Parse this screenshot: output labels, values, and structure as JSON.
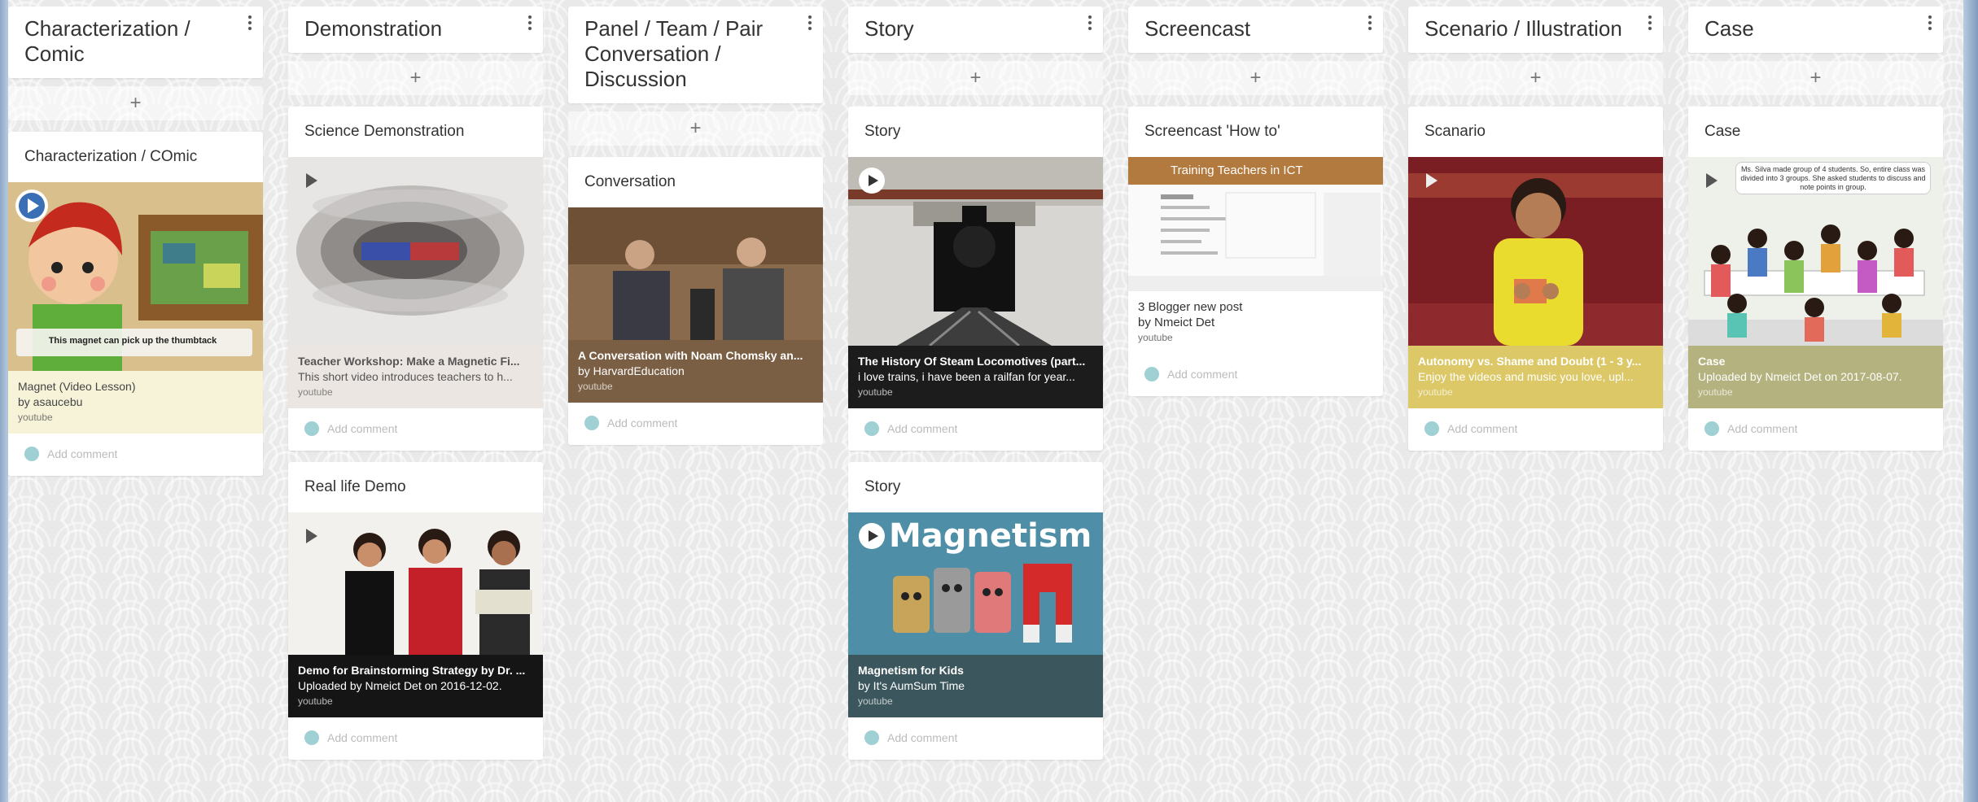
{
  "columns": [
    {
      "title": "Characterization / Comic",
      "add_label": "+",
      "posts": [
        {
          "title": "Characterization / COmic",
          "attachment": {
            "title": "Magnet (Video Lesson)",
            "description": "by asaucebu",
            "source": "youtube",
            "caption": "This magnet can pick up the thumbtack"
          },
          "comment_placeholder": "Add comment"
        }
      ]
    },
    {
      "title": "Demonstration",
      "add_label": "+",
      "posts": [
        {
          "title": "Science Demonstration",
          "attachment": {
            "title": "Teacher Workshop: Make a Magnetic Fi...",
            "description": "This short video introduces teachers to h...",
            "source": "youtube"
          },
          "comment_placeholder": "Add comment"
        },
        {
          "title": "Real life Demo",
          "attachment": {
            "title": "Demo for Brainstorming Strategy by Dr. ...",
            "description": "Uploaded by Nmeict Det on 2016-12-02.",
            "source": "youtube"
          },
          "comment_placeholder": "Add comment"
        }
      ]
    },
    {
      "title": "Panel / Team / Pair Conversation / Discussion",
      "add_label": "+",
      "posts": [
        {
          "title": "Conversation",
          "attachment": {
            "title": "A Conversation with Noam Chomsky an...",
            "description": "by HarvardEducation",
            "source": "youtube"
          },
          "comment_placeholder": "Add comment"
        }
      ]
    },
    {
      "title": "Story",
      "add_label": "+",
      "posts": [
        {
          "title": "Story",
          "attachment": {
            "title": "The History Of Steam Locomotives (part...",
            "description": "i love trains, i have been a railfan for year...",
            "source": "youtube"
          },
          "comment_placeholder": "Add comment"
        },
        {
          "title": "Story",
          "attachment": {
            "title": "Magnetism for Kids",
            "description": "by It's AumSum Time",
            "source": "youtube",
            "caption": "Magnetism"
          },
          "comment_placeholder": "Add comment"
        }
      ]
    },
    {
      "title": "Screencast",
      "add_label": "+",
      "posts": [
        {
          "title": "Screencast 'How to'",
          "attachment": {
            "title": "3 Blogger new post",
            "description": "by Nmeict Det",
            "source": "youtube",
            "caption": "Training Teachers in ICT"
          },
          "comment_placeholder": "Add comment"
        }
      ]
    },
    {
      "title": "Scenario / Illustration",
      "add_label": "+",
      "posts": [
        {
          "title": "Scanario",
          "attachment": {
            "title": "Autonomy vs. Shame and Doubt (1 - 3 y...",
            "description": "Enjoy the videos and music you love, upl...",
            "source": "youtube"
          },
          "comment_placeholder": "Add comment"
        }
      ]
    },
    {
      "title": "Case",
      "add_label": "+",
      "posts": [
        {
          "title": "Case",
          "attachment": {
            "title": "Case",
            "description": "Uploaded by Nmeict Det on 2017-08-07.",
            "source": "youtube",
            "caption": "Ms. Silva made group of 4 students. So, entire class was divided into 3 groups. She asked students to discuss and note points in group."
          },
          "comment_placeholder": "Add comment"
        }
      ]
    }
  ]
}
